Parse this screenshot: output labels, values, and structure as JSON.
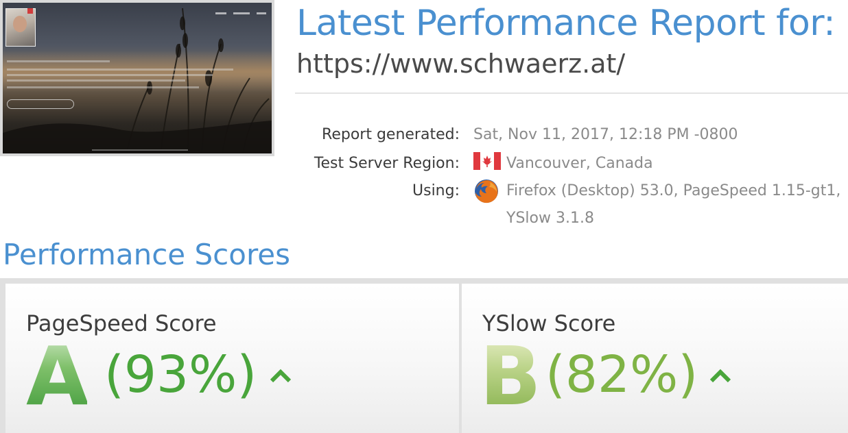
{
  "header": {
    "title": "Latest Performance Report for:",
    "url": "https://www.schwaerz.at/"
  },
  "report": {
    "generated_label": "Report generated:",
    "generated_value": "Sat, Nov 11, 2017, 12:18 PM -0800",
    "region_label": "Test Server Region:",
    "region_value": "Vancouver, Canada",
    "using_label": "Using:",
    "using_value_line1": "Firefox (Desktop) 53.0, PageSpeed 1.15-gt1,",
    "using_value_line2": "YSlow 3.1.8",
    "region_icon": "canada-flag-icon",
    "browser_icon": "firefox-icon"
  },
  "scores": {
    "heading": "Performance Scores",
    "pagespeed": {
      "label": "PageSpeed Score",
      "grade": "A",
      "percent_text": "(93%)",
      "percent": 93,
      "trend": "up",
      "color": "#49a53b"
    },
    "yslow": {
      "label": "YSlow Score",
      "grade": "B",
      "percent_text": "(82%)",
      "percent": 82,
      "trend": "up",
      "color": "#7fb345"
    }
  },
  "colors": {
    "heading_blue": "#4a90d0",
    "grade_a_green": "#49a53b",
    "grade_b_green": "#7fb345"
  }
}
